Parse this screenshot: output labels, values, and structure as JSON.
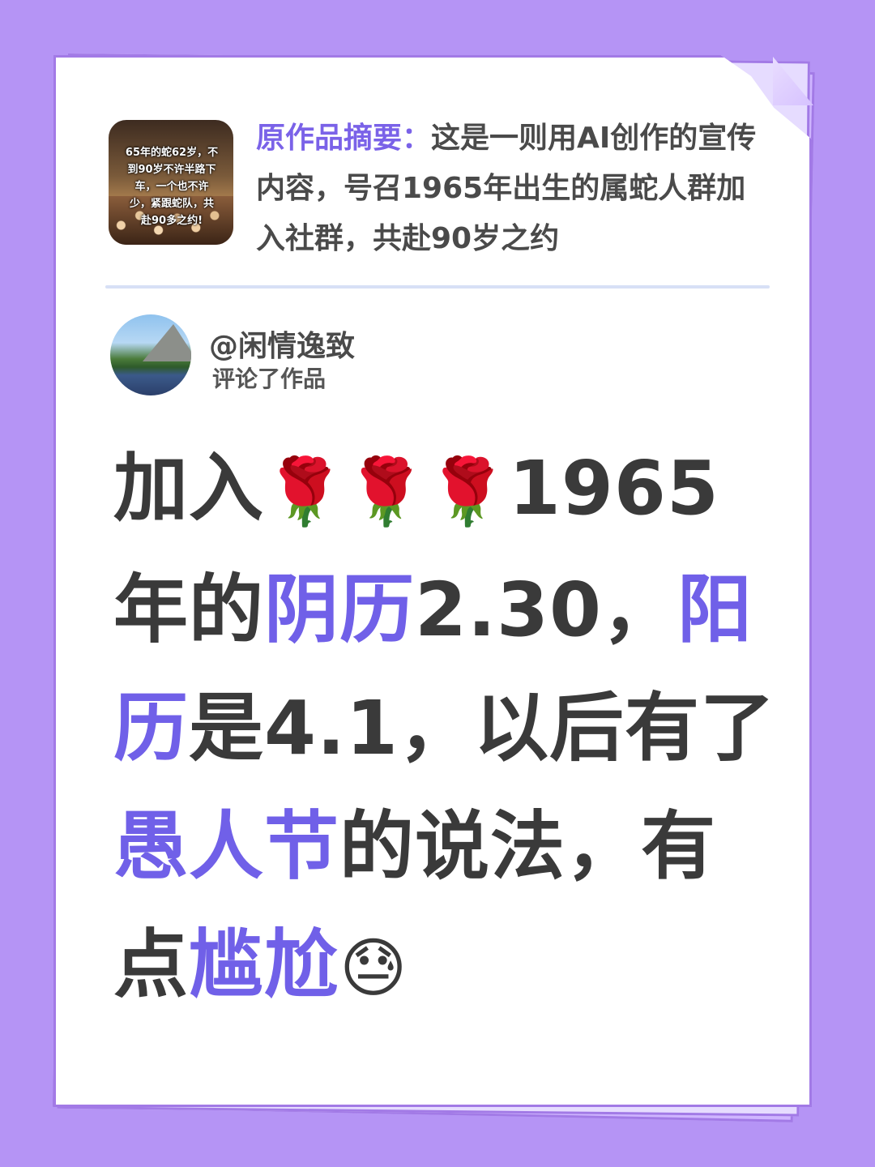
{
  "summary": {
    "label": "原作品摘要：",
    "text": "这是一则用AI创作的宣传内容，号召1965年出生的属蛇人群加入社群，共赴90岁之约"
  },
  "thumbnail": {
    "overlay_text": "65年的蛇62岁，不\n到90岁不许半路下\n车，一个也不许\n少，紧跟蛇队，共\n赴90多之约!"
  },
  "commenter": {
    "handle": "@闲情逸致",
    "action": "评论了作品"
  },
  "comment": {
    "seg1": "加入",
    "emoji_rose1": "🌹",
    "emoji_rose2": "🌹",
    "emoji_rose3": "🌹",
    "seg2": "1965年的",
    "hl1": "阴历",
    "seg3": "2.30，",
    "hl2": "阳历",
    "seg4": "是4.1，以后有了",
    "hl3": "愚人节",
    "seg5": "的说法，有点",
    "hl4": "尴尬",
    "emoji_end": "😓"
  },
  "colors": {
    "background": "#b594f5",
    "accent": "#7060e8",
    "text": "#3a3a3a"
  }
}
